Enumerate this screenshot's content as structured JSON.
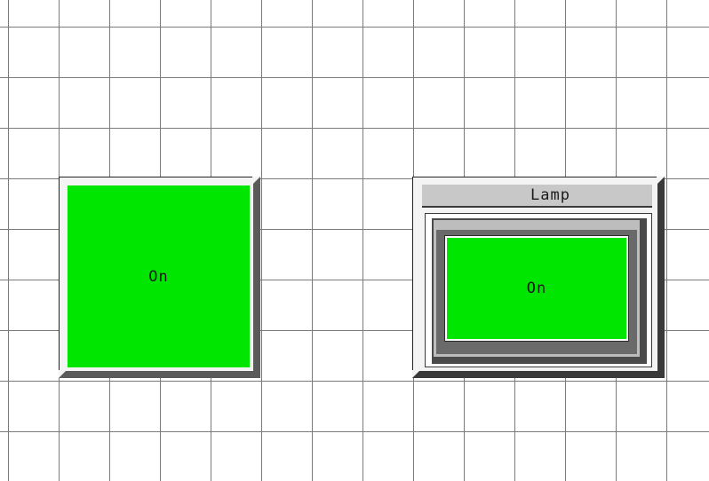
{
  "canvas": {
    "grid_color": "#7a7a7a",
    "background_color": "#ffffff"
  },
  "button_widget": {
    "state_label": "On",
    "face_color": "#00e600"
  },
  "lamp_widget": {
    "title": "Lamp",
    "state_label": "On",
    "face_color": "#00e600"
  }
}
